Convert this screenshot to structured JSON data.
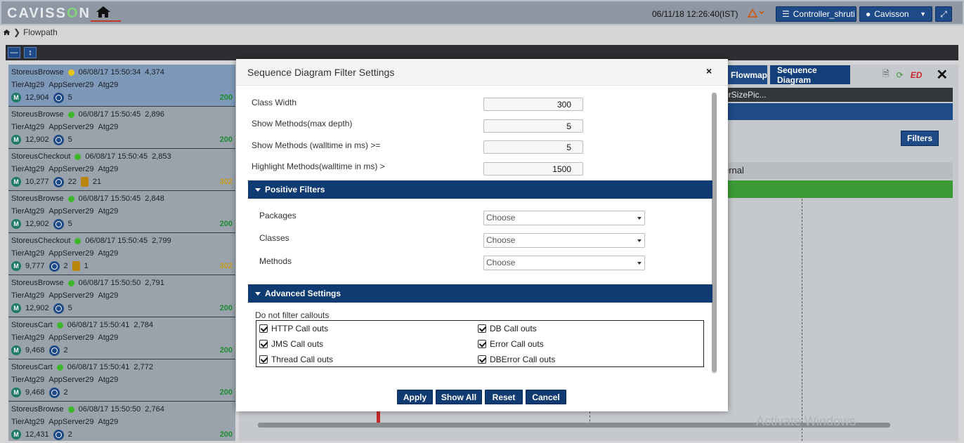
{
  "header": {
    "logo_text_pre": "CAVISS",
    "logo_text_o": "O",
    "logo_text_post": "N",
    "datetime": "06/11/18 12:26:40(IST)",
    "controller_label": "Controller_shruti",
    "user_label": "Cavisson"
  },
  "breadcrumb": {
    "current": "Flowpath"
  },
  "flowpaths": [
    {
      "name": "StoreusBrowse",
      "dot": "#e6c619",
      "time": "06/08/17 15:50:34",
      "resp": "4,374",
      "tier": "TierAtg29",
      "server": "AppServer29",
      "app": "Atg29",
      "methods": "12,904",
      "calls": "5",
      "db": "",
      "status": "200",
      "selected": true
    },
    {
      "name": "StoreusBrowse",
      "dot": "#3cb528",
      "time": "06/08/17 15:50:45",
      "resp": "2,896",
      "tier": "TierAtg29",
      "server": "AppServer29",
      "app": "Atg29",
      "methods": "12,902",
      "calls": "5",
      "db": "",
      "status": "200"
    },
    {
      "name": "StoreusCheckout",
      "dot": "#3cb528",
      "time": "06/08/17 15:50:45",
      "resp": "2,853",
      "tier": "TierAtg29",
      "server": "AppServer29",
      "app": "Atg29",
      "methods": "10,277",
      "calls": "22",
      "db": "21",
      "status": "302"
    },
    {
      "name": "StoreusBrowse",
      "dot": "#3cb528",
      "time": "06/08/17 15:50:45",
      "resp": "2,848",
      "tier": "TierAtg29",
      "server": "AppServer29",
      "app": "Atg29",
      "methods": "12,902",
      "calls": "5",
      "db": "",
      "status": "200"
    },
    {
      "name": "StoreusCheckout",
      "dot": "#3cb528",
      "time": "06/08/17 15:50:45",
      "resp": "2,799",
      "tier": "TierAtg29",
      "server": "AppServer29",
      "app": "Atg29",
      "methods": "9,777",
      "calls": "2",
      "db": "1",
      "status": "302"
    },
    {
      "name": "StoreusBrowse",
      "dot": "#3cb528",
      "time": "06/08/17 15:50:50",
      "resp": "2,791",
      "tier": "TierAtg29",
      "server": "AppServer29",
      "app": "Atg29",
      "methods": "12,902",
      "calls": "5",
      "db": "",
      "status": "200"
    },
    {
      "name": "StoreusCart",
      "dot": "#3cb528",
      "time": "06/08/17 15:50:41",
      "resp": "2,784",
      "tier": "TierAtg29",
      "server": "AppServer29",
      "app": "Atg29",
      "methods": "9,468",
      "calls": "2",
      "db": "",
      "status": "200"
    },
    {
      "name": "StoreusCart",
      "dot": "#3cb528",
      "time": "06/08/17 15:50:41",
      "resp": "2,772",
      "tier": "TierAtg29",
      "server": "AppServer29",
      "app": "Atg29",
      "methods": "9,468",
      "calls": "2",
      "db": "",
      "status": "200"
    },
    {
      "name": "StoreusBrowse",
      "dot": "#3cb528",
      "time": "06/08/17 15:50:50",
      "resp": "2,764",
      "tier": "TierAtg29",
      "server": "AppServer29",
      "app": "Atg29",
      "methods": "12,431",
      "calls": "2",
      "db": "",
      "status": "200"
    }
  ],
  "background": {
    "tab_flowmap": "Flowmap",
    "tab_sequence": "Sequence Diagram",
    "strip_text": "orSizePic...",
    "filters_label": "Filters",
    "gray_row_text": "ernal",
    "watermark": "Activate Windows"
  },
  "modal": {
    "title": "Sequence Diagram Filter Settings",
    "close_glyph": "×",
    "fields": [
      {
        "label": "Class Width",
        "value": "300"
      },
      {
        "label": "Show Methods(max depth)",
        "value": "5"
      },
      {
        "label": "Show Methods (walltime in ms) >=",
        "value": "5"
      },
      {
        "label": "Highlight Methods(walltime in ms) >",
        "value": "1500"
      }
    ],
    "positive_filters": {
      "title": "Positive Filters",
      "rows": [
        {
          "label": "Packages",
          "value": "Choose"
        },
        {
          "label": "Classes",
          "value": "Choose"
        },
        {
          "label": "Methods",
          "value": "Choose"
        }
      ]
    },
    "advanced": {
      "title": "Advanced Settings",
      "callouts_label": "Do not filter callouts",
      "checkboxes": [
        {
          "label": "HTTP Call outs",
          "checked": true
        },
        {
          "label": "DB Call outs",
          "checked": true
        },
        {
          "label": "JMS Call outs",
          "checked": true
        },
        {
          "label": "Error Call outs",
          "checked": true
        },
        {
          "label": "Thread Call outs",
          "checked": true
        },
        {
          "label": "DBError Call outs",
          "checked": true
        }
      ]
    },
    "buttons": {
      "apply": "Apply",
      "show_all": "Show All",
      "reset": "Reset",
      "cancel": "Cancel"
    }
  },
  "colors": {
    "primary": "#0f3a72",
    "accent_green": "#3c9a35",
    "status_ok": "#1d8a2f",
    "status_redirect": "#c79a16"
  }
}
